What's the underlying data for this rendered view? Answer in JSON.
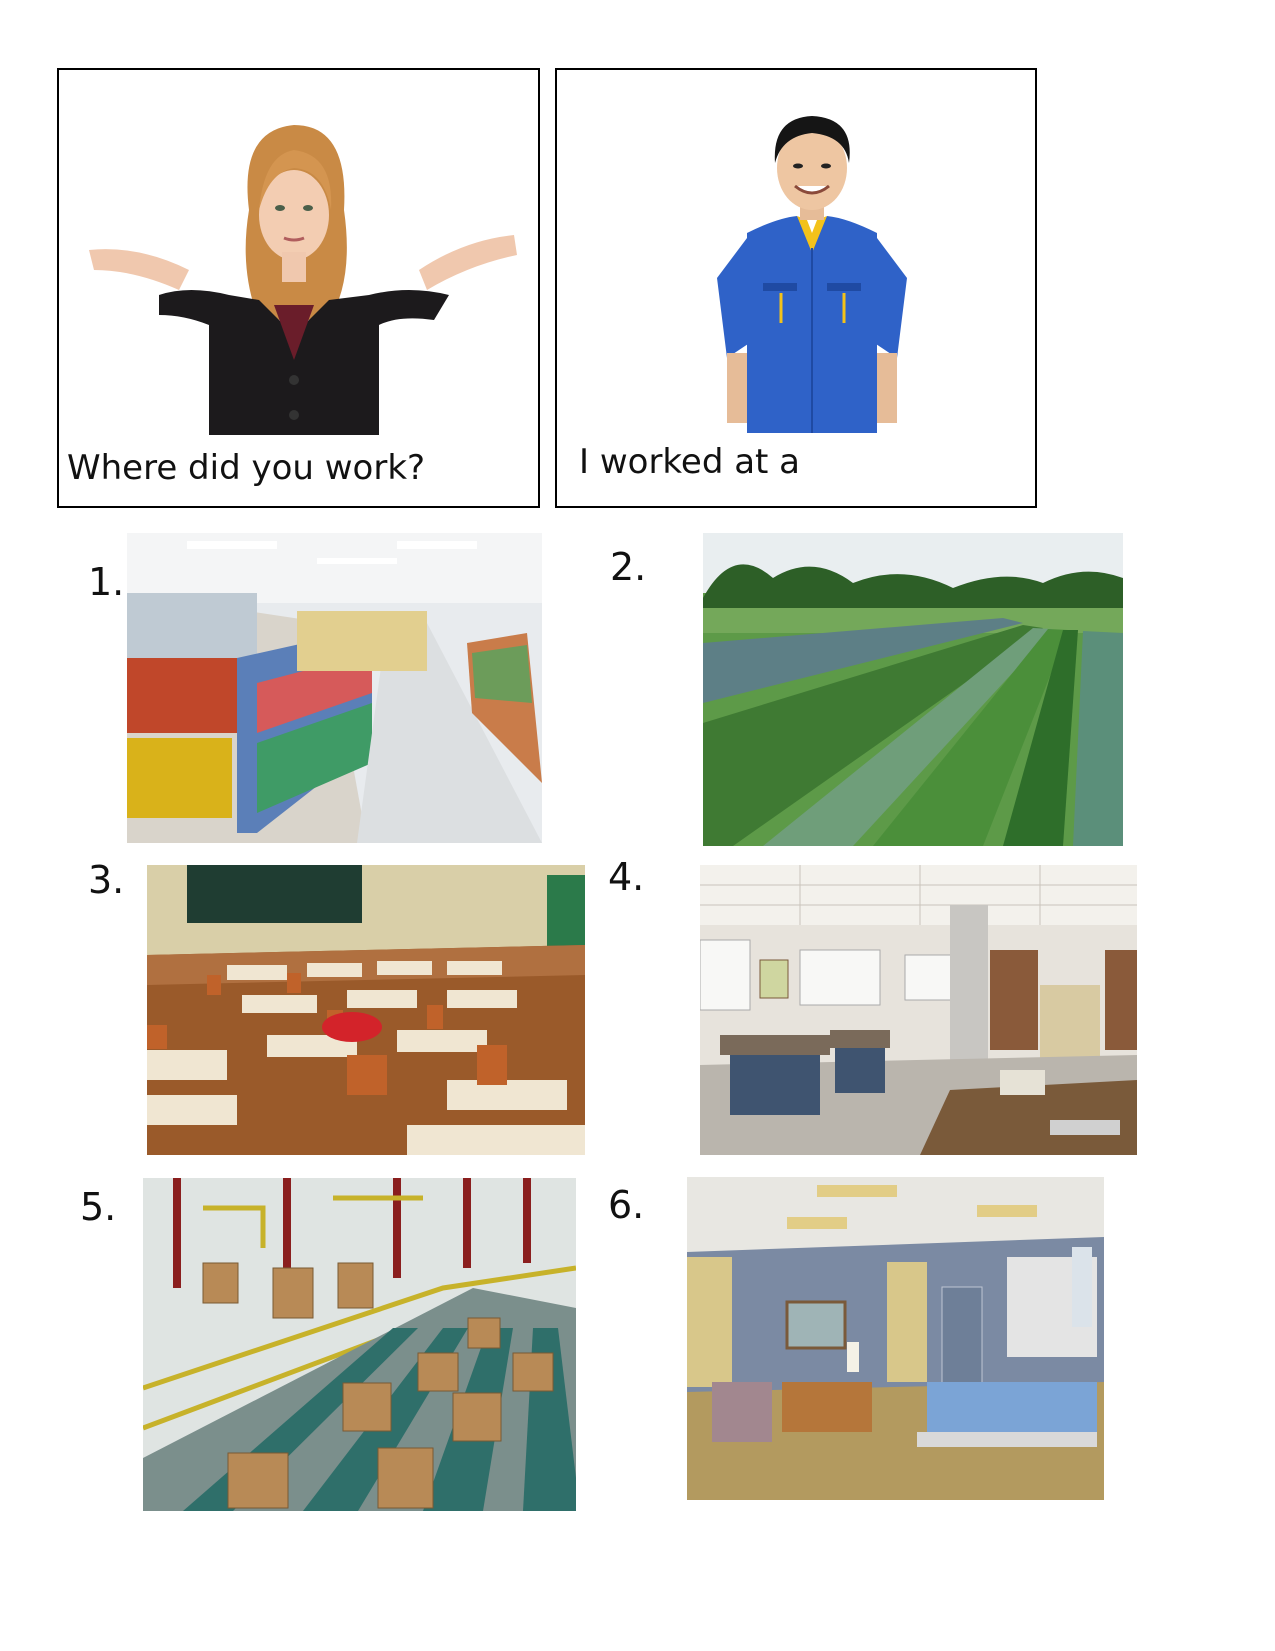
{
  "question_card": {
    "caption": "Where did you work?",
    "figure": "woman-shrugging"
  },
  "answer_card": {
    "caption": "I worked at a",
    "figure": "man-in-blue-work-uniform"
  },
  "places": [
    {
      "number": "1.",
      "scene": "store-aisle"
    },
    {
      "number": "2.",
      "scene": "farm-field"
    },
    {
      "number": "3.",
      "scene": "classroom"
    },
    {
      "number": "4.",
      "scene": "office"
    },
    {
      "number": "5.",
      "scene": "factory-conveyor"
    },
    {
      "number": "6.",
      "scene": "hospital-room"
    }
  ],
  "colors": {
    "suit": "#1c1a1c",
    "hair": "#c98a45",
    "shirt_blue": "#2f62c8",
    "field_green": "#3f8a3a",
    "floor_wood": "#9a5a2a",
    "box_cardboard": "#c4955e"
  }
}
